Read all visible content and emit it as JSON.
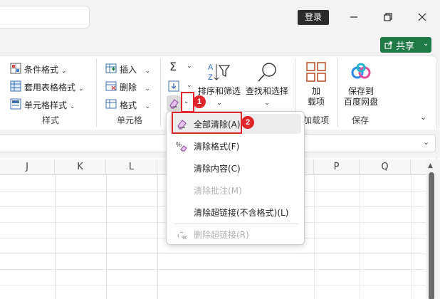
{
  "titlebar": {
    "login_label": "登录"
  },
  "share": {
    "label": "共享"
  },
  "ribbon": {
    "styles": {
      "conditional_format": "条件格式",
      "table_format": "套用表格格式",
      "cell_style": "单元格样式",
      "group_label": "样式"
    },
    "cells": {
      "insert": "插入",
      "delete": "删除",
      "format": "格式",
      "group_label": "单元格"
    },
    "editing": {
      "sort_filter": "排序和筛选",
      "find_select": "查找和选择"
    },
    "addins": {
      "label_line1": "加",
      "label_line2": "载项",
      "group_label": "加载项"
    },
    "save": {
      "label_line1": "保存到",
      "label_line2": "百度网盘",
      "group_label": "保存"
    }
  },
  "grid": {
    "columns": [
      "J",
      "K",
      "L",
      "P",
      "Q"
    ]
  },
  "clear_menu": {
    "items": [
      {
        "label": "全部清除(A)",
        "enabled": true,
        "icon": "eraser-icon"
      },
      {
        "label": "清除格式(F)",
        "enabled": true,
        "icon": "clear-format-icon"
      },
      {
        "label": "清除内容(C)",
        "enabled": true,
        "icon": ""
      },
      {
        "label": "清除批注(M)",
        "enabled": false,
        "icon": ""
      },
      {
        "label": "清除超链接(不含格式)(L)",
        "enabled": true,
        "icon": ""
      },
      {
        "label": "删除超链接(R)",
        "enabled": false,
        "icon": "remove-link-icon"
      }
    ]
  },
  "annotations": {
    "step1": "1",
    "step2": "2"
  },
  "colors": {
    "accent_green": "#1f7a45",
    "annotation_red": "#e0262b"
  }
}
